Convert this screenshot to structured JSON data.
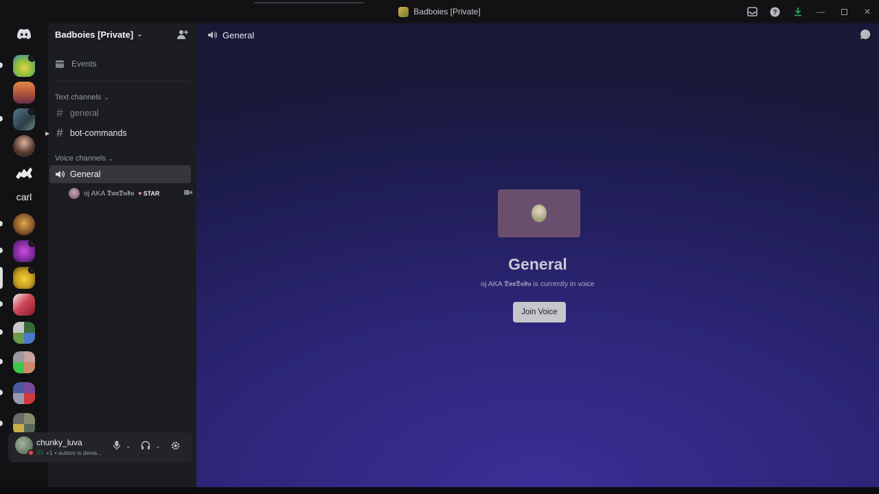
{
  "window": {
    "title": "Badboies [Private]"
  },
  "rail": {
    "text_server": "carl"
  },
  "server": {
    "name": "Badboies [Private]"
  },
  "sidebar": {
    "events_label": "Events",
    "text_category": "Text channels",
    "text_channels": [
      "general",
      "bot-commands"
    ],
    "voice_category": "Voice channels",
    "voice_channels": [
      "General"
    ],
    "voice_user": {
      "name": "oj AKA 𝕯𝖔𝖓𝕯𝖆𝖉𝖆",
      "tag": "STAR"
    }
  },
  "user_panel": {
    "username": "chunky_luva",
    "status_prefix": "+1",
    "status_text": "• autism is devia..."
  },
  "main": {
    "header_channel": "General",
    "voice_title": "General",
    "voice_subtitle": "oj AKA 𝕯𝖔𝖓𝕯𝖆𝖉𝖆 is currently in voice",
    "join_label": "Join Voice"
  },
  "colors": {
    "accent_green": "#23a559",
    "dnd_red": "#f23f43",
    "sidebar_bg": "#1c1d21",
    "rail_bg": "#121214"
  }
}
